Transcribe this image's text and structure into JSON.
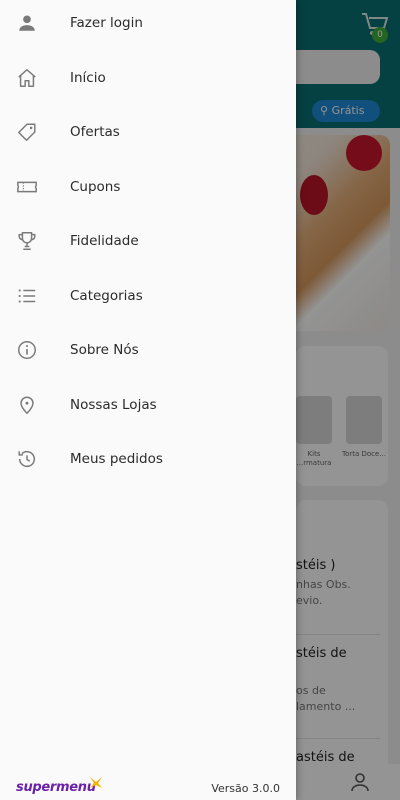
{
  "drawer": {
    "items": [
      {
        "label": "Fazer login",
        "icon": "user-icon"
      },
      {
        "label": "Início",
        "icon": "home-icon"
      },
      {
        "label": "Ofertas",
        "icon": "tag-icon"
      },
      {
        "label": "Cupons",
        "icon": "ticket-icon"
      },
      {
        "label": "Fidelidade",
        "icon": "trophy-icon"
      },
      {
        "label": "Categorias",
        "icon": "list-icon"
      },
      {
        "label": "Sobre Nós",
        "icon": "info-icon"
      },
      {
        "label": "Nossas Lojas",
        "icon": "location-pin-icon"
      },
      {
        "label": "Meus pedidos",
        "icon": "history-icon"
      }
    ],
    "footer": {
      "brand": "supermenu",
      "version": "Versão 3.0.0"
    }
  },
  "background": {
    "cart_count": "0",
    "delivery_badge": "Grátis",
    "category_thumbs": [
      "Kits ...rmatura",
      "Torta Doce..."
    ],
    "products": [
      {
        "title": "stéis )",
        "desc1": "nhas Obs.",
        "desc2": "evio."
      },
      {
        "title": "stéis de",
        "desc1": "os de",
        "desc2": "lamento ..."
      },
      {
        "title": "astéis de",
        "desc1": "",
        "desc2": ""
      }
    ]
  },
  "colors": {
    "header": "#0a6e73",
    "brand": "#6b21a8",
    "badge_green": "#3fae3a",
    "pill_blue": "#1e88d6"
  }
}
